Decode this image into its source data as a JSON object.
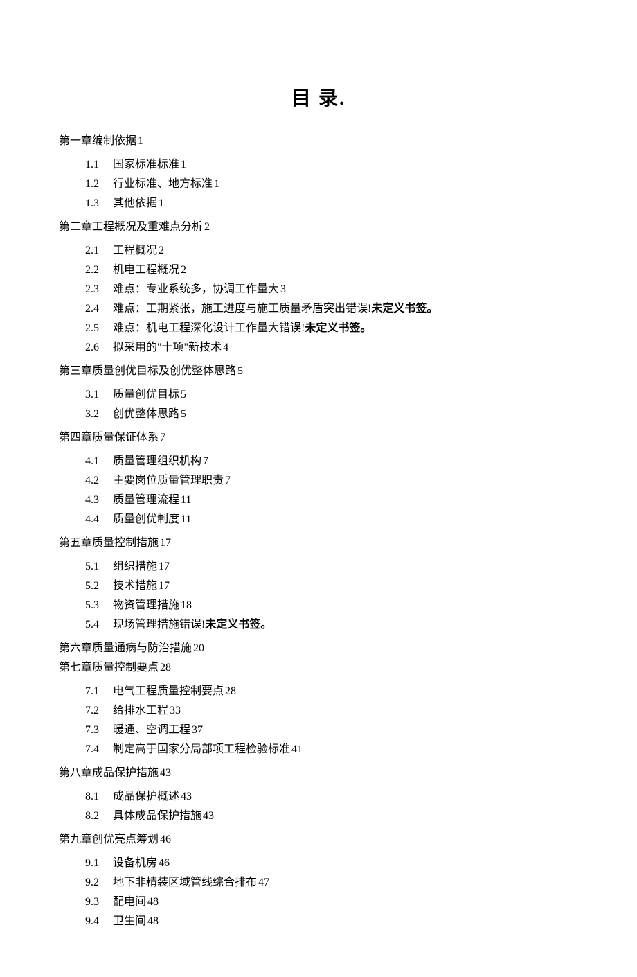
{
  "title": "目 录.",
  "error_prefix": "错误!",
  "error_text": "未定义书签。",
  "chapters": [
    {
      "label": "第一章编制依据",
      "page": "1",
      "sections": [
        {
          "num": "1.1",
          "label": "国家标准标准",
          "page": "1"
        },
        {
          "num": "1.2",
          "label": "行业标准、地方标准",
          "page": "1"
        },
        {
          "num": "1.3",
          "label": "其他依据",
          "page": "1"
        }
      ]
    },
    {
      "label": "第二章工程概况及重难点分析",
      "page": "2",
      "sections": [
        {
          "num": "2.1",
          "label": "工程概况",
          "page": "2"
        },
        {
          "num": "2.2",
          "label": "机电工程概况",
          "page": "2"
        },
        {
          "num": "2.3",
          "label": "难点：专业系统多，协调工作量大",
          "page": "3"
        },
        {
          "num": "2.4",
          "label": "难点：工期紧张，施工进度与施工质量矛盾突出",
          "error": true
        },
        {
          "num": "2.5",
          "label": "难点：机电工程深化设计工作量大",
          "error": true
        },
        {
          "num": "2.6",
          "label": "拟采用的\"十项\"新技术",
          "page": "4"
        }
      ]
    },
    {
      "label": "第三章质量创优目标及创优整体思路",
      "page": "5",
      "sections": [
        {
          "num": "3.1",
          "label": "质量创优目标",
          "page": "5"
        },
        {
          "num": "3.2",
          "label": "创优整体思路",
          "page": "5"
        }
      ]
    },
    {
      "label": "第四章质量保证体系",
      "page": "7",
      "sections": [
        {
          "num": "4.1",
          "label": "质量管理组织机构",
          "page": "7"
        },
        {
          "num": "4.2",
          "label": "主要岗位质量管理职责",
          "page": "7"
        },
        {
          "num": "4.3",
          "label": "质量管理流程",
          "page": "11"
        },
        {
          "num": "4.4",
          "label": "质量创优制度",
          "page": "11"
        }
      ]
    },
    {
      "label": "第五章质量控制措施",
      "page": "17",
      "sections": [
        {
          "num": "5.1",
          "label": "组织措施",
          "page": "17"
        },
        {
          "num": "5.2",
          "label": "技术措施",
          "page": "17"
        },
        {
          "num": "5.3",
          "label": "物资管理措施",
          "page": "18"
        },
        {
          "num": "5.4",
          "label": "现场管理措施",
          "error": true
        }
      ]
    },
    {
      "label": "第六章质量通病与防治措施",
      "page": "20",
      "sections": []
    },
    {
      "label": "第七章质量控制要点",
      "page": "28",
      "sections": [
        {
          "num": "7.1",
          "label": "电气工程质量控制要点",
          "page": "28"
        },
        {
          "num": "7.2",
          "label": "给排水工程",
          "page": "33"
        },
        {
          "num": "7.3",
          "label": "暖通、空调工程",
          "page": "37"
        },
        {
          "num": "7.4",
          "label": "制定高于国家分局部项工程检验标准",
          "page": "41"
        }
      ]
    },
    {
      "label": "第八章成品保护措施",
      "page": "43",
      "sections": [
        {
          "num": "8.1",
          "label": "成品保护概述",
          "page": "43"
        },
        {
          "num": "8.2",
          "label": "具体成品保护措施",
          "page": "43"
        }
      ]
    },
    {
      "label": "第九章创优亮点筹划",
      "page": "46",
      "sections": [
        {
          "num": "9.1",
          "label": "设备机房",
          "page": "46"
        },
        {
          "num": "9.2",
          "label": "地下非精装区域管线综合排布",
          "page": "47"
        },
        {
          "num": "9.3",
          "label": "配电间",
          "page": "48"
        },
        {
          "num": "9.4",
          "label": "卫生间",
          "page": "48"
        }
      ]
    }
  ]
}
